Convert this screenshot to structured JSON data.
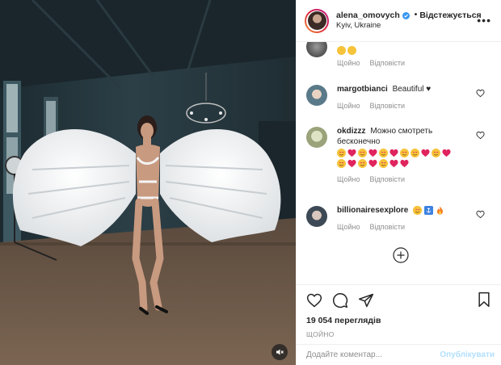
{
  "header": {
    "username": "alena_omovych",
    "separator": "•",
    "follow_label": "Відстежується",
    "location": "Kyiv, Ukraine",
    "more_label": "•••"
  },
  "comments": [
    {
      "username": "",
      "text": "",
      "emojis": [
        "grinning-sweat",
        "grinning-sweat"
      ],
      "meta_time": "Щойно",
      "meta_reply": "Відповісти"
    },
    {
      "username": "margotbianci",
      "text": "Beautiful ♥",
      "meta_time": "Щойно",
      "meta_reply": "Відповісти"
    },
    {
      "username": "okdizzz",
      "text": "Можно смотреть бесконечно",
      "emojis": [
        "heart-eyes",
        "heart",
        "heart-eyes",
        "heart",
        "heart-eyes",
        "heart",
        "heart-eyes",
        "heart-eyes",
        "heart",
        "heart-eyes",
        "heart",
        "heart-eyes",
        "heart",
        "heart-eyes",
        "heart",
        "heart-eyes",
        "heart",
        "heart"
      ],
      "meta_time": "Щойно",
      "meta_reply": "Відповісти"
    },
    {
      "username": "billionairesexplore",
      "text": "",
      "emojis": [
        "heart-eyes",
        "anchor-square",
        "fire"
      ],
      "meta_time": "Щойно",
      "meta_reply": "Відповісти"
    }
  ],
  "actions": {
    "views": "19 054 переглядів",
    "time": "ЩОЙНО"
  },
  "add_comment": {
    "placeholder": "Додайте коментар...",
    "publish_label": "Опублікувати"
  },
  "icons": {
    "like": "heart-outline-icon",
    "comment": "comment-bubble-icon",
    "share": "paper-plane-icon",
    "save": "bookmark-icon",
    "load_more": "plus-circle-icon",
    "mute": "speaker-muted-icon",
    "verified": "verified-badge-icon"
  },
  "colors": {
    "accent": "#0095f6",
    "publish_disabled": "#b2dffc",
    "muted_text": "#8e8e8e",
    "text": "#262626",
    "heart_red": "#e0245e"
  }
}
